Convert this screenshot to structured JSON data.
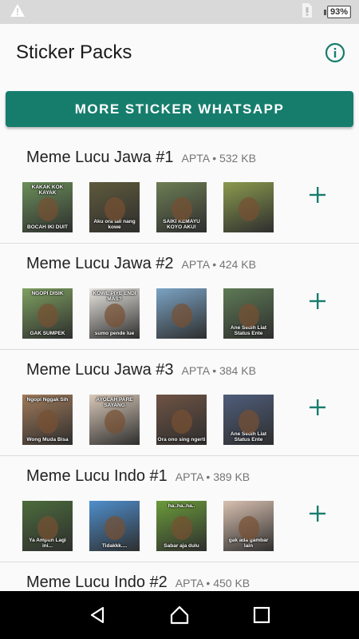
{
  "status_bar": {
    "warning_icon": "warning-icon",
    "sim_icon": "sim-card-icon",
    "battery_level": "93%",
    "battery_fraction": 0.93
  },
  "app_bar": {
    "title": "Sticker Packs",
    "info_icon": "info-icon"
  },
  "more_button": {
    "label": "MORE STICKER WHATSAPP",
    "color": "#167d6d"
  },
  "packs": [
    {
      "name": "Meme Lucu Jawa #1",
      "meta": "APTA • 532 KB",
      "stickers": [
        {
          "top": "KAKAK KOK KAYAK",
          "bottom": "BOCAH IKI DUIT",
          "bg": "#6b8f5a"
        },
        {
          "top": "",
          "bottom": "Aku ora lali nang kowe",
          "bg": "#5f5a3c"
        },
        {
          "top": "",
          "bottom": "SAIKI KEMAYU KOYO AKU!",
          "bg": "#6d7d55"
        },
        {
          "top": "",
          "bottom": "",
          "bg": "#8a9a4e"
        }
      ]
    },
    {
      "name": "Meme Lucu Jawa #2",
      "meta": "APTA • 424 KB",
      "stickers": [
        {
          "top": "NGOPI DISIK",
          "bottom": "GAK SUMPEK",
          "bg": "#7ea060"
        },
        {
          "top": "KOWE PIYE ENDI MAS?",
          "bottom": "sumo pende lue",
          "bg": "#e9e6e0"
        },
        {
          "top": "",
          "bottom": "",
          "bg": "#7ba3c4"
        },
        {
          "top": "",
          "bottom": "Ane Sedih Liat Status Ente",
          "bg": "#5e7a55"
        }
      ]
    },
    {
      "name": "Meme Lucu Jawa #3",
      "meta": "APTA • 384 KB",
      "stickers": [
        {
          "top": "Ngopi Nggak Sih",
          "bottom": "Wong Muda Bisa",
          "bg": "#a07a5a"
        },
        {
          "top": "AYOLAH PARE SAYANG",
          "bottom": "",
          "bg": "#d8c8b8"
        },
        {
          "top": "",
          "bottom": "Ora ono sing ngerti",
          "bg": "#6e5344"
        },
        {
          "top": "",
          "bottom": "Ane Sedih Liat Status Ente",
          "bg": "#4f5d7a"
        }
      ]
    },
    {
      "name": "Meme Lucu Indo #1",
      "meta": "APTA • 389 KB",
      "stickers": [
        {
          "top": "",
          "bottom": "Ya Ampun Lagi ini...",
          "bg": "#4c6b3c"
        },
        {
          "top": "",
          "bottom": "Tidakkk....",
          "bg": "#4f8ecc"
        },
        {
          "top": "ha..ha..ha..",
          "bottom": "Sabar aja dulu",
          "bg": "#6b9b3a"
        },
        {
          "top": "",
          "bottom": "gak ada gambar lain",
          "bg": "#d8c0b0"
        }
      ]
    },
    {
      "name": "Meme Lucu Indo #2",
      "meta": "APTA • 450 KB",
      "stickers": [
        {
          "top": "",
          "bottom": "",
          "bg": "#777777"
        },
        {
          "top": "",
          "bottom": "",
          "bg": "#888888"
        },
        {
          "top": "",
          "bottom": "",
          "bg": "#999999"
        },
        {
          "top": "",
          "bottom": "",
          "bg": "#aaaaaa"
        }
      ]
    }
  ],
  "add_icon": "plus-icon",
  "accent_color": "#167d6d",
  "nav_bar": {
    "back_icon": "back-triangle-icon",
    "home_icon": "home-icon",
    "recents_icon": "recents-square-icon"
  }
}
